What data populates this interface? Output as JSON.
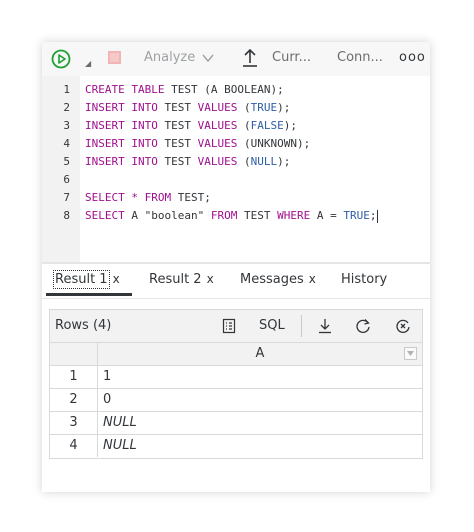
{
  "toolbar": {
    "run_icon": "play-circle-icon",
    "analyze_label": "Analyze",
    "current_label": "Curr...",
    "connection_label": "Conn...",
    "more_label": "ooo",
    "colors": {
      "run": "#1aa12e",
      "stop": "#f6c9c9"
    }
  },
  "editor": {
    "lines": [
      {
        "num": "1",
        "tokens": [
          {
            "t": "CREATE",
            "c": "kw"
          },
          {
            "t": " "
          },
          {
            "t": "TABLE",
            "c": "kw"
          },
          {
            "t": " TEST (A BOOLEAN);",
            "c": "id"
          }
        ]
      },
      {
        "num": "2",
        "tokens": [
          {
            "t": "INSERT",
            "c": "kw"
          },
          {
            "t": " "
          },
          {
            "t": "INTO",
            "c": "kw"
          },
          {
            "t": " TEST ",
            "c": "id"
          },
          {
            "t": "VALUES",
            "c": "kw"
          },
          {
            "t": " (",
            "c": "id"
          },
          {
            "t": "TRUE",
            "c": "val"
          },
          {
            "t": ");",
            "c": "id"
          }
        ]
      },
      {
        "num": "3",
        "tokens": [
          {
            "t": "INSERT",
            "c": "kw"
          },
          {
            "t": " "
          },
          {
            "t": "INTO",
            "c": "kw"
          },
          {
            "t": " TEST ",
            "c": "id"
          },
          {
            "t": "VALUES",
            "c": "kw"
          },
          {
            "t": " (",
            "c": "id"
          },
          {
            "t": "FALSE",
            "c": "val"
          },
          {
            "t": ");",
            "c": "id"
          }
        ]
      },
      {
        "num": "4",
        "tokens": [
          {
            "t": "INSERT",
            "c": "kw"
          },
          {
            "t": " "
          },
          {
            "t": "INTO",
            "c": "kw"
          },
          {
            "t": " TEST ",
            "c": "id"
          },
          {
            "t": "VALUES",
            "c": "kw"
          },
          {
            "t": " (UNKNOWN);",
            "c": "id"
          }
        ]
      },
      {
        "num": "5",
        "tokens": [
          {
            "t": "INSERT",
            "c": "kw"
          },
          {
            "t": " "
          },
          {
            "t": "INTO",
            "c": "kw"
          },
          {
            "t": " TEST ",
            "c": "id"
          },
          {
            "t": "VALUES",
            "c": "kw"
          },
          {
            "t": " (",
            "c": "id"
          },
          {
            "t": "NULL",
            "c": "val"
          },
          {
            "t": ");",
            "c": "id"
          }
        ]
      },
      {
        "num": "6",
        "tokens": []
      },
      {
        "num": "7",
        "tokens": [
          {
            "t": "SELECT",
            "c": "kw"
          },
          {
            "t": " "
          },
          {
            "t": "*",
            "c": "kw"
          },
          {
            "t": " "
          },
          {
            "t": "FROM",
            "c": "kw"
          },
          {
            "t": " TEST;",
            "c": "id"
          }
        ]
      },
      {
        "num": "8",
        "tokens": [
          {
            "t": "SELECT",
            "c": "kw"
          },
          {
            "t": " A \"boolean\" ",
            "c": "id"
          },
          {
            "t": "FROM",
            "c": "kw"
          },
          {
            "t": " TEST ",
            "c": "id"
          },
          {
            "t": "WHERE",
            "c": "kw"
          },
          {
            "t": " A = ",
            "c": "id"
          },
          {
            "t": "TRUE",
            "c": "val"
          },
          {
            "t": ";",
            "c": "id"
          }
        ],
        "caret": true
      }
    ],
    "colors": {
      "keyword": "#a00f8e",
      "value": "#2e5ea6"
    }
  },
  "tabs": [
    {
      "label": "Result 1",
      "closable": true,
      "active": true
    },
    {
      "label": "Result 2",
      "closable": true,
      "active": false
    },
    {
      "label": "Messages",
      "closable": true,
      "active": false
    },
    {
      "label": "History",
      "closable": false,
      "active": false
    }
  ],
  "result": {
    "rows_label": "Rows (4)",
    "sql_label": "SQL",
    "column_header": "A",
    "rows": [
      {
        "idx": "1",
        "value": "1",
        "null": false
      },
      {
        "idx": "2",
        "value": "0",
        "null": false
      },
      {
        "idx": "3",
        "value": "NULL",
        "null": true
      },
      {
        "idx": "4",
        "value": "NULL",
        "null": true
      }
    ]
  }
}
